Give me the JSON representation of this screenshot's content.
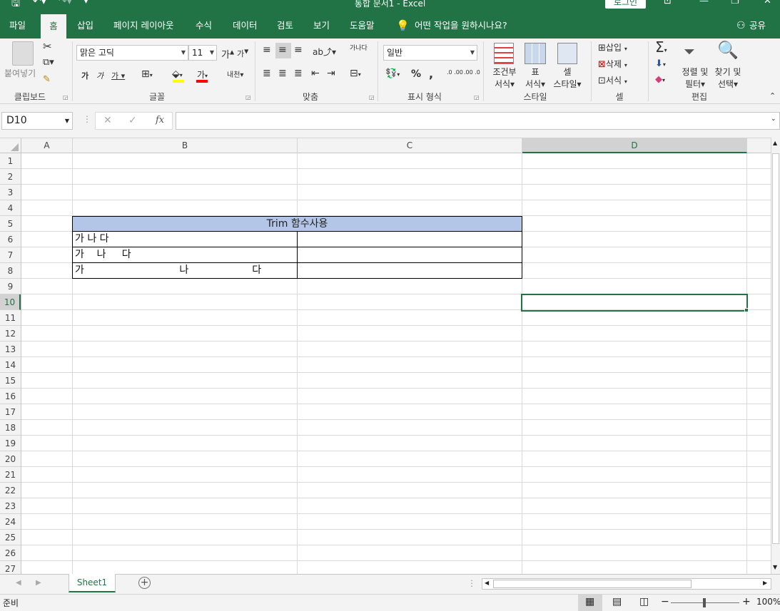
{
  "window": {
    "title": "통합 문서1  -  Excel",
    "login": "로그인"
  },
  "tabs": [
    "파일",
    "홈",
    "삽입",
    "페이지 레이아웃",
    "수식",
    "데이터",
    "검토",
    "보기",
    "도움말"
  ],
  "tell_me": "어떤 작업을 원하시나요?",
  "share": "공유",
  "ribbon": {
    "clipboard": {
      "paste": "붙여넣기",
      "label": "클립보드"
    },
    "font": {
      "name": "맑은 고딕",
      "size": "11",
      "grow": "가",
      "shrink": "가",
      "bold": "가",
      "italic": "가",
      "underline": "가",
      "font_color": "가",
      "phonetic": "내천",
      "label": "글꼴"
    },
    "alignment": {
      "label": "맞춤",
      "wrap": "가나다"
    },
    "number": {
      "format": "일반",
      "percent": "%",
      "comma": ",",
      "inc": ".0 .00",
      "dec": ".00 .0",
      "label": "표시 형식"
    },
    "styles": {
      "cond1": "조건부",
      "cond2": "서식",
      "table1": "표",
      "table2": "서식",
      "cell1": "셀",
      "cell2": "스타일",
      "label": "스타일"
    },
    "cells": {
      "insert": "삽입",
      "delete": "삭제",
      "format": "서식",
      "label": "셀"
    },
    "editing": {
      "sort1": "정렬 및",
      "sort2": "필터",
      "find1": "찾기 및",
      "find2": "선택",
      "label": "편집"
    }
  },
  "formula_bar": {
    "name_box": "D10",
    "cancel": "✕",
    "enter": "✓",
    "fx": "fx",
    "value": ""
  },
  "columns": [
    "A",
    "B",
    "C",
    "D"
  ],
  "rows": [
    "1",
    "2",
    "3",
    "4",
    "5",
    "6",
    "7",
    "8",
    "9",
    "10",
    "11",
    "12",
    "13",
    "14",
    "15",
    "16",
    "17",
    "18",
    "19",
    "20",
    "21",
    "22",
    "23",
    "24",
    "25",
    "26",
    "27"
  ],
  "cells": {
    "B5": "Trim 함수사용",
    "B6": "가 나 다",
    "B7": "가    나     다",
    "B8": "가                              나                    다"
  },
  "selected_cell": "D10",
  "sheets": [
    "Sheet1"
  ],
  "status": {
    "mode": "준비",
    "zoom": "100%"
  },
  "colors": {
    "accent": "#217346",
    "header_fill": "#b4c6e7",
    "selection": "#217346"
  }
}
